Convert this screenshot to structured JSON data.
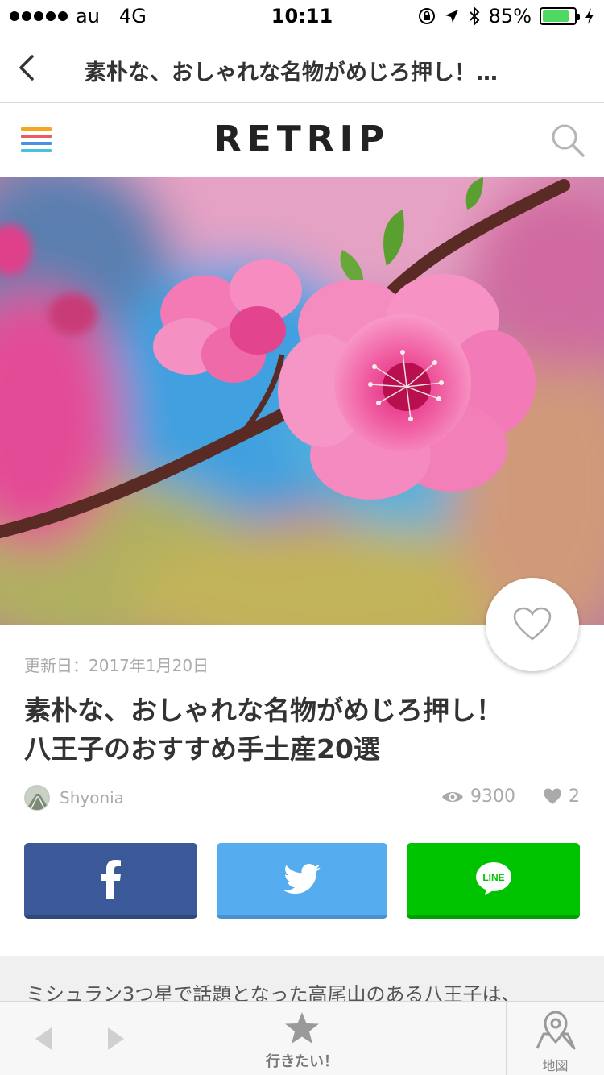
{
  "status_bar": {
    "carrier": "au",
    "network": "4G",
    "time": "10:11",
    "battery_percent": "85%",
    "battery_level": 0.85
  },
  "nav": {
    "title": "素朴な、おしゃれな名物がめじろ押し！…"
  },
  "header": {
    "logo": "RETRIP",
    "menu_colors": [
      "#f5a623",
      "#e85d5d",
      "#4a90e2",
      "#4ac0e2"
    ]
  },
  "article": {
    "updated": "更新日：2017年1月20日",
    "title_line1": "素朴な、おしゃれな名物がめじろ押し！",
    "title_line2": "八王子のおすすめ手土産20選",
    "author": "Shyonia",
    "views": "9300",
    "likes": "2",
    "intro": "ミシュラン3つ星で話題となった高尾山のある八王子は、"
  },
  "share": {
    "facebook_color": "#3b5998",
    "twitter_color": "#55acee",
    "line_color": "#00c300",
    "line_label": "LINE"
  },
  "toolbar": {
    "want_label": "行きたい！",
    "map_label": "地図"
  }
}
